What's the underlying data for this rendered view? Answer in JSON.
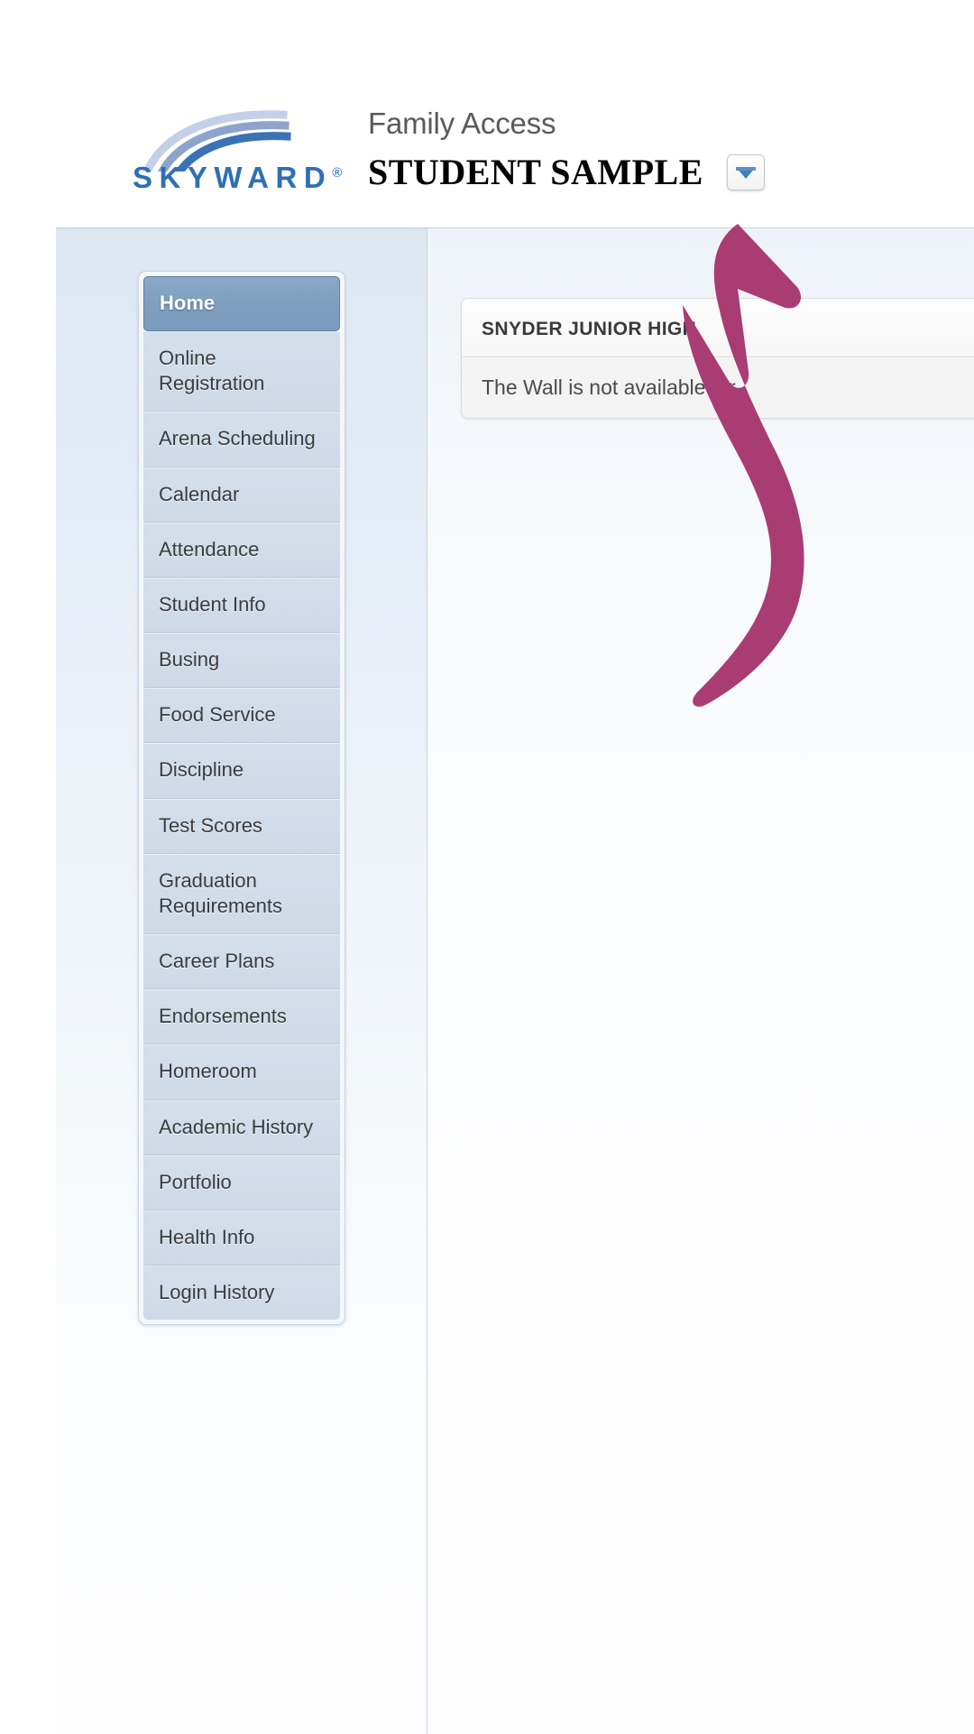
{
  "header": {
    "logo_text": "SKYWARD",
    "logo_registered": "®",
    "product_title": "Family Access",
    "student_name": "STUDENT SAMPLE",
    "student_dropdown_icon": "chevron-down-icon"
  },
  "sidebar": {
    "items": [
      {
        "label": "Home",
        "active": true
      },
      {
        "label": "Online Registration",
        "active": false
      },
      {
        "label": "Arena Scheduling",
        "active": false
      },
      {
        "label": "Calendar",
        "active": false
      },
      {
        "label": "Attendance",
        "active": false
      },
      {
        "label": "Student Info",
        "active": false
      },
      {
        "label": "Busing",
        "active": false
      },
      {
        "label": "Food Service",
        "active": false
      },
      {
        "label": "Discipline",
        "active": false
      },
      {
        "label": "Test Scores",
        "active": false
      },
      {
        "label": "Graduation Requirements",
        "active": false
      },
      {
        "label": "Career Plans",
        "active": false
      },
      {
        "label": "Endorsements",
        "active": false
      },
      {
        "label": "Homeroom",
        "active": false
      },
      {
        "label": "Academic History",
        "active": false
      },
      {
        "label": "Portfolio",
        "active": false
      },
      {
        "label": "Health Info",
        "active": false
      },
      {
        "label": "Login History",
        "active": false
      }
    ]
  },
  "content": {
    "panel_title": "SNYDER JUNIOR HIGH",
    "panel_message": "The Wall is not available for"
  },
  "annotation": {
    "type": "curved-arrow",
    "color": "#a93c72",
    "points_to": "student-dropdown-button"
  },
  "colors": {
    "accent_blue": "#2f6fb4",
    "menu_active": "#7f9fc0",
    "annotation": "#a93c72",
    "page_background": "#ffffff"
  }
}
